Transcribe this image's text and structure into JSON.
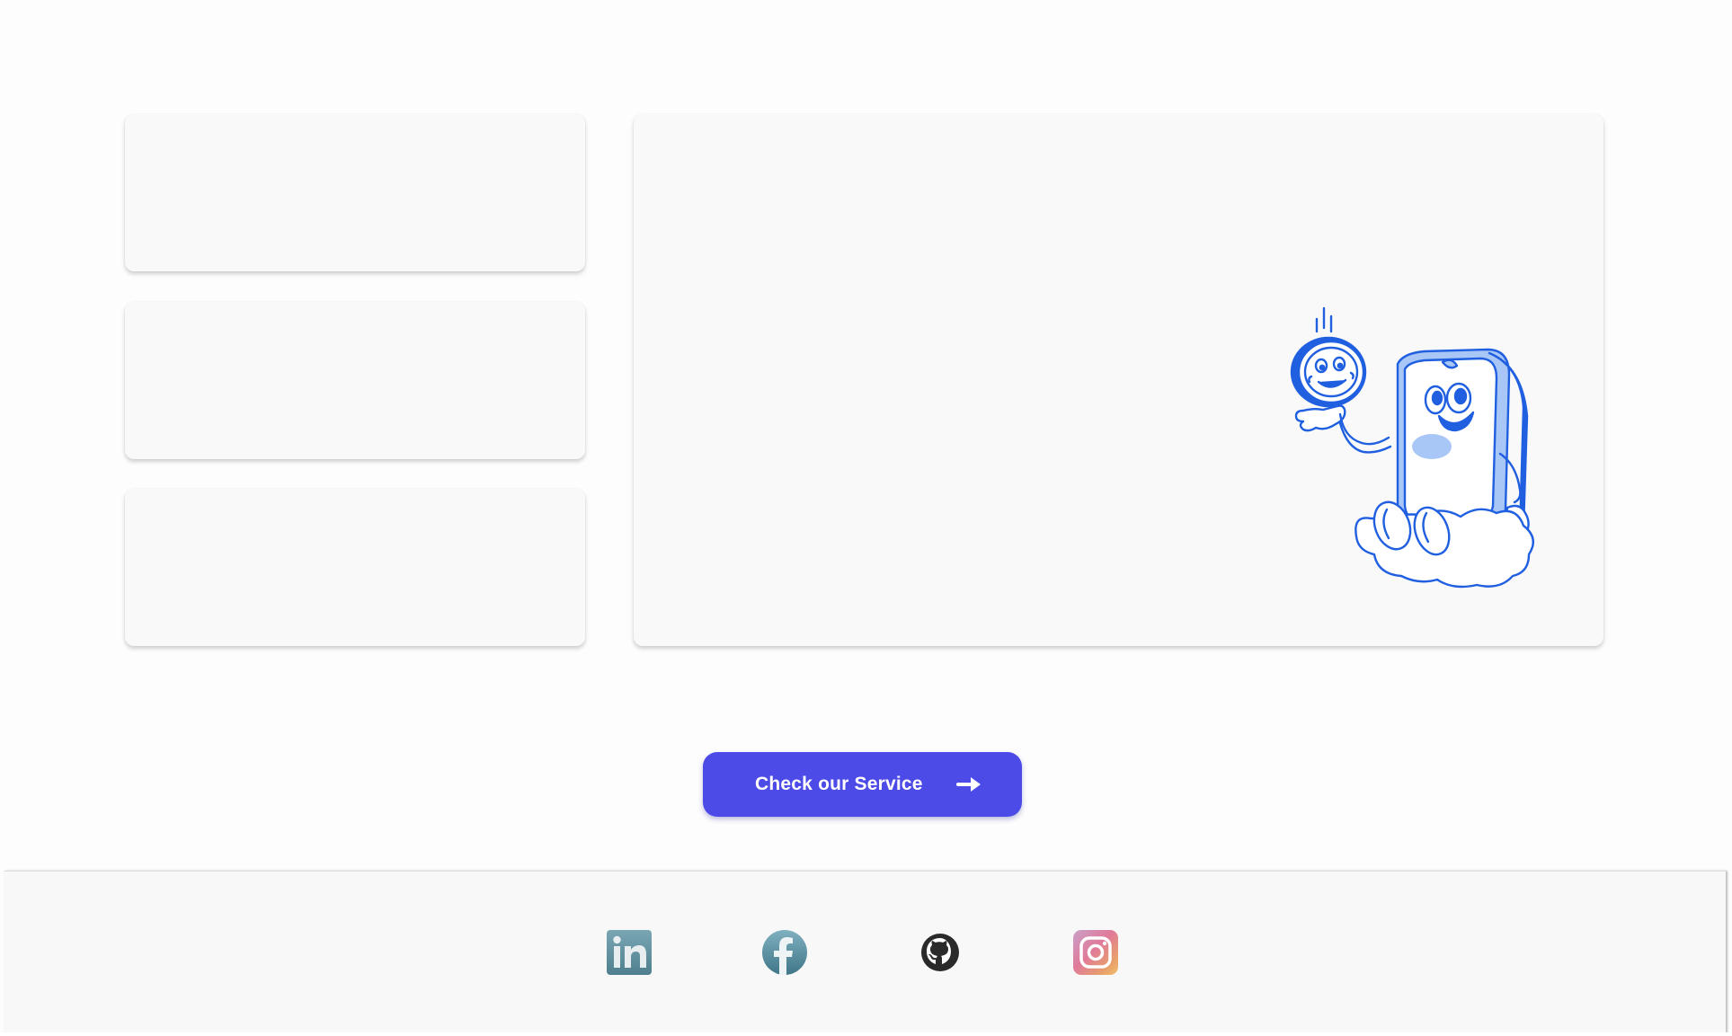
{
  "cards": {
    "left": [
      "",
      "",
      ""
    ],
    "main": ""
  },
  "illustration": {
    "name": "coin-and-banknote-mascot",
    "color": "#1f5fe0"
  },
  "cta": {
    "label": "Check our Service",
    "icon": "arrow-right-icon",
    "background": "#4c4be8",
    "text_color": "#ffffff"
  },
  "footer": {
    "social_links": [
      {
        "name": "linkedin",
        "icon": "linkedin-icon"
      },
      {
        "name": "facebook",
        "icon": "facebook-icon"
      },
      {
        "name": "github",
        "icon": "github-icon"
      },
      {
        "name": "instagram",
        "icon": "instagram-icon"
      }
    ]
  }
}
